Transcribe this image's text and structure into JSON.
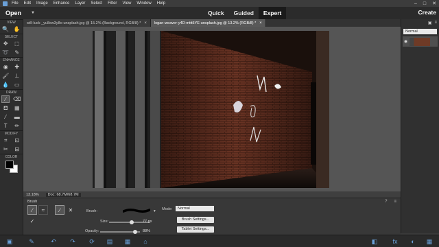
{
  "menu": {
    "items": [
      "File",
      "Edit",
      "Image",
      "Enhance",
      "Layer",
      "Select",
      "Filter",
      "View",
      "Window",
      "Help"
    ]
  },
  "window_controls": [
    "–",
    "□",
    "✕"
  ],
  "modebar": {
    "open_label": "Open",
    "modes": [
      "Quick",
      "Guided",
      "Expert"
    ],
    "active_mode": "Expert",
    "create_label": "Create"
  },
  "toolbox": {
    "sections": {
      "view": "VIEW",
      "select": "SELECT",
      "enhance": "ENHANCE",
      "draw": "DRAW",
      "modify": "MODIFY",
      "color": "COLOR"
    }
  },
  "tabs": [
    {
      "label": "will-luck-_yu8xw3y8o-unsplash.jpg @ 15.2% (Background, RGB/8) *",
      "active": false
    },
    {
      "label": "logan-weaver-y4D-mttt5YE-unsplash.jpg @ 13.2% (RGB/8) *",
      "active": true
    }
  ],
  "status": {
    "zoom": "13.18%",
    "doc": "Doc: 68.7M/68.7M"
  },
  "layers": {
    "blend_mode": "Normal"
  },
  "options": {
    "title": "Brush",
    "brush_label": "Brush:",
    "size_label": "Size:",
    "size_value": "77 px",
    "size_fraction": 0.55,
    "opacity_label": "Opacity:",
    "opacity_value": "88%",
    "opacity_fraction": 0.88,
    "mode_label": "Mode:",
    "mode_value": "Normal",
    "brush_settings": "Brush Settings...",
    "tablet_settings": "Tablet Settings..."
  },
  "colors": {
    "accent": "#6aa0d8",
    "active_mode_bg": "#1a1a1a"
  }
}
